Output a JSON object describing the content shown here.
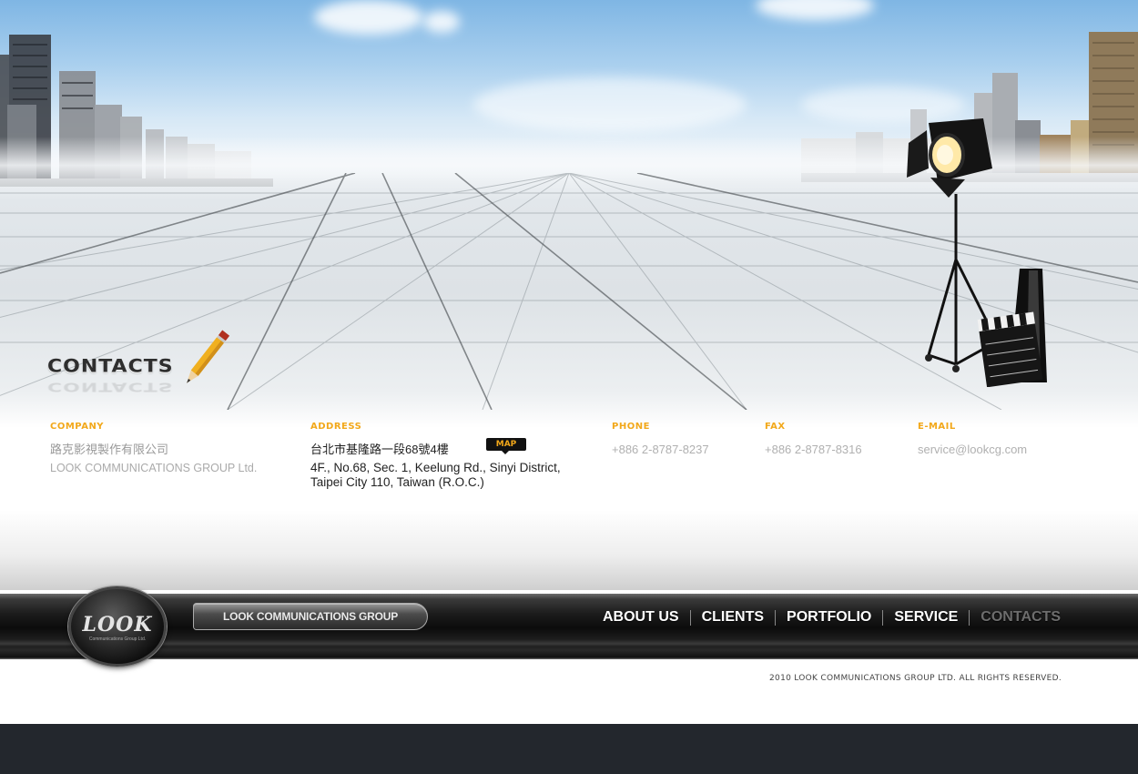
{
  "section": {
    "heading": "CONTACTS"
  },
  "contacts": {
    "company": {
      "label": "COMPANY",
      "name_zh": "路克影視製作有限公司",
      "name_en": "LOOK COMMUNICATIONS GROUP Ltd."
    },
    "address": {
      "label": "ADDRESS",
      "line_zh": "台北市基隆路一段68號4樓",
      "line_en_1": "4F., No.68, Sec. 1, Keelung Rd., Sinyi District,",
      "line_en_2": "Taipei City 110, Taiwan (R.O.C.)",
      "map_label": "MAP"
    },
    "phone": {
      "label": "PHONE",
      "value": "+886 2-8787-8237"
    },
    "fax": {
      "label": "FAX",
      "value": "+886 2-8787-8316"
    },
    "email": {
      "label": "E-MAIL",
      "value": "service@lookcg.com"
    }
  },
  "footer": {
    "logo_text": "LOOK",
    "logo_subtext": "Communications Group Ltd.",
    "group_label": "LOOK COMMUNICATIONS GROUP",
    "nav": [
      {
        "label": "ABOUT US",
        "active": false
      },
      {
        "label": "CLIENTS",
        "active": false
      },
      {
        "label": "PORTFOLIO",
        "active": false
      },
      {
        "label": "SERVICE",
        "active": false
      },
      {
        "label": "CONTACTS",
        "active": true
      }
    ],
    "copyright": "2010 LOOK COMMUNICATIONS GROUP LTD. ALL RIGHTS RESERVED."
  },
  "colors": {
    "accent_label": "#f2a81a",
    "nav_text": "#ffffff",
    "nav_active": "#6d6d6d",
    "page_bottom": "#23272d"
  }
}
